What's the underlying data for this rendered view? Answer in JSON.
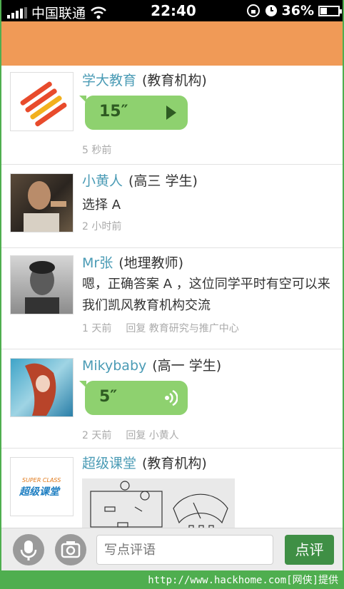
{
  "status_bar": {
    "carrier": "中国联通",
    "time": "22:40",
    "battery": "36%"
  },
  "header": {},
  "feed": [
    {
      "name": "学大教育",
      "role": "(教育机构)",
      "voice": "15″",
      "meta": "5 秒前"
    },
    {
      "name": "小黄人",
      "role": "(高三 学生)",
      "text": "选择 A",
      "meta": "2 小时前"
    },
    {
      "name": "Mr张",
      "role": "(地理教师)",
      "text": "嗯，正确答案 A ，这位同学平时有空可以来我们凯风教育机构交流",
      "meta": "1 天前",
      "reply": "回复 教育研究与推广中心"
    },
    {
      "name": "Mikybaby",
      "role": "(高一 学生)",
      "voice": "5″",
      "meta": "2 天前",
      "reply": "回复 小黄人"
    },
    {
      "name": "超级课堂",
      "role": "(教育机构)",
      "logo_text": "SUPER CLASS",
      "logo_text_cn": "超级课堂"
    }
  ],
  "bottom_bar": {
    "input_placeholder": "写点评语",
    "send_label": "点评"
  },
  "footer": {
    "credit": "http://www.hackhome.com[网侠]提供"
  }
}
